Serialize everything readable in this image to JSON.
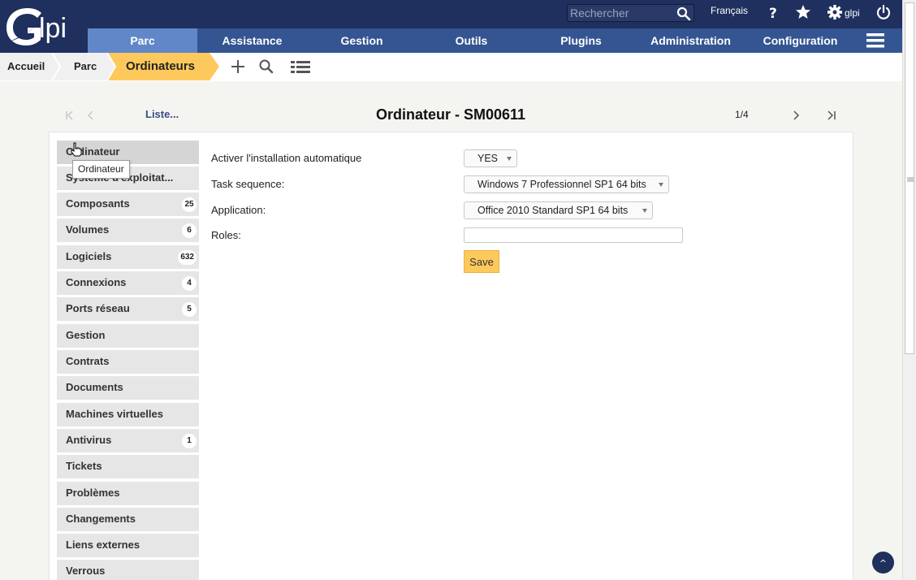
{
  "header": {
    "logo_text": "Glpi",
    "search_placeholder": "Rechercher",
    "language": "Français",
    "username": "glpi",
    "help_icon": "question-icon",
    "favorites_icon": "star-icon",
    "settings_icon": "gear-icon",
    "logout_icon": "power-icon"
  },
  "nav": {
    "items": [
      {
        "label": "Parc",
        "active": true
      },
      {
        "label": "Assistance"
      },
      {
        "label": "Gestion"
      },
      {
        "label": "Outils"
      },
      {
        "label": "Plugins"
      },
      {
        "label": "Administration"
      },
      {
        "label": "Configuration"
      }
    ],
    "menu_icon": "hamburger-icon"
  },
  "breadcrumb": {
    "items": [
      "Accueil",
      "Parc",
      "Ordinateurs"
    ],
    "actions": [
      "plus-icon",
      "search-icon",
      "list-icon"
    ]
  },
  "record_nav": {
    "title": "Ordinateur - SM00611",
    "list_link": "Liste...",
    "counter": "1/4"
  },
  "tabs": [
    {
      "label": "Ordinateur",
      "active": true
    },
    {
      "label": "Système d'exploitat..."
    },
    {
      "label": "Composants",
      "badge": "25"
    },
    {
      "label": "Volumes",
      "badge": "6"
    },
    {
      "label": "Logiciels",
      "badge": "632"
    },
    {
      "label": "Connexions",
      "badge": "4"
    },
    {
      "label": "Ports réseau",
      "badge": "5"
    },
    {
      "label": "Gestion"
    },
    {
      "label": "Contrats"
    },
    {
      "label": "Documents"
    },
    {
      "label": "Machines virtuelles"
    },
    {
      "label": "Antivirus",
      "badge": "1"
    },
    {
      "label": "Tickets"
    },
    {
      "label": "Problèmes"
    },
    {
      "label": "Changements"
    },
    {
      "label": "Liens externes"
    },
    {
      "label": "Verrous"
    }
  ],
  "form": {
    "auto_install_label": "Activer l'installation automatique",
    "auto_install_value": "YES",
    "task_sequence_label": "Task sequence:",
    "task_sequence_value": "Windows 7 Professionnel SP1 64 bits",
    "application_label": "Application:",
    "application_value": "Office 2010 Standard SP1 64 bits",
    "roles_label": "Roles:",
    "roles_value": "",
    "save_label": "Save"
  },
  "tooltip": "Ordinateur",
  "back_to_top": "^",
  "colors": {
    "header_bg": "#1f2f5e",
    "nav_bg": "#345591",
    "nav_active": "#6187c8",
    "accent": "#fec95c"
  }
}
